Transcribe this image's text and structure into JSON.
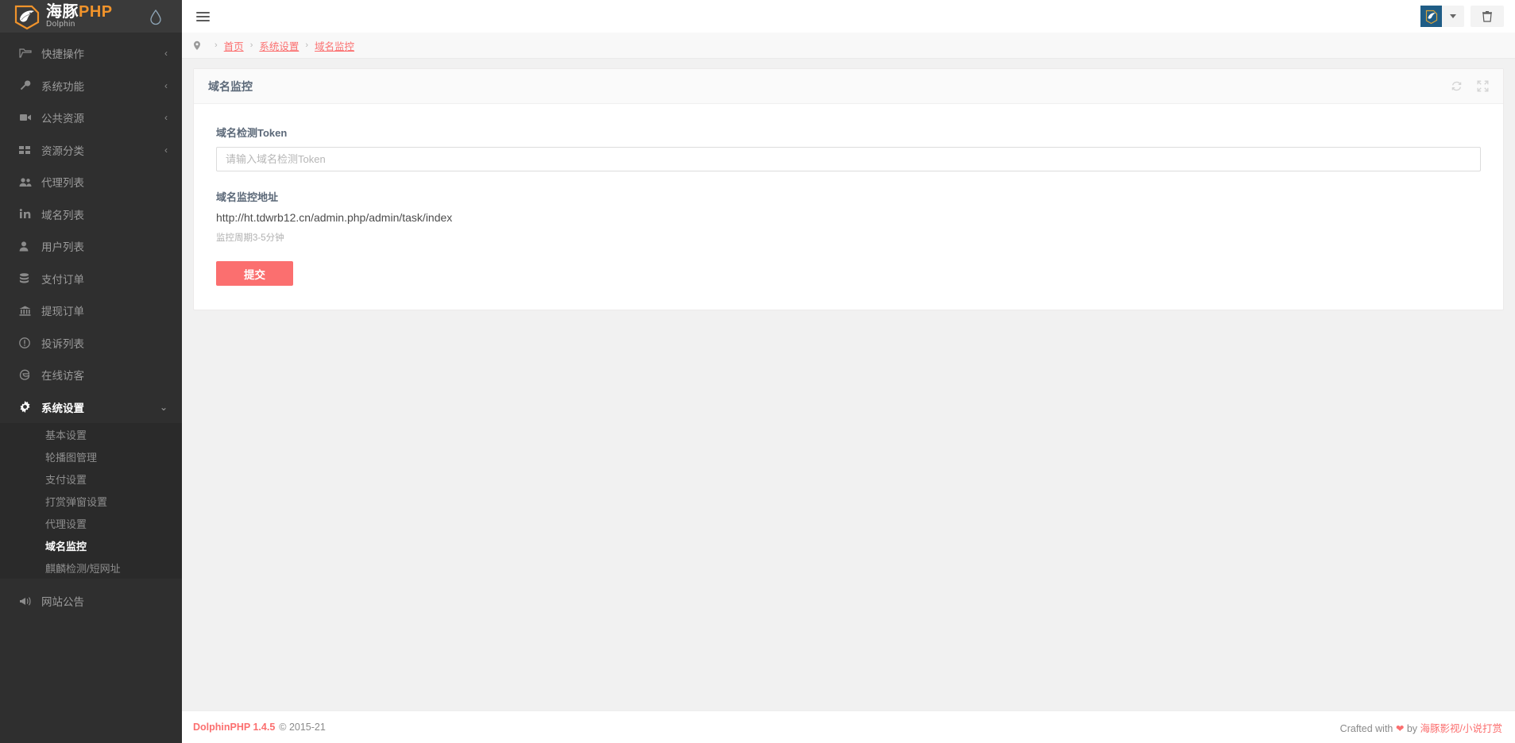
{
  "colors": {
    "sidebar_bg": "#2f2f2f",
    "submenu_bg": "#2a2a2a",
    "accent_red": "#fb6f6f",
    "logo_orange": "#f0932b",
    "avatar_blue": "#1f5d86"
  },
  "logo": {
    "cn": "海豚",
    "php": "PHP",
    "sub": "Dolphin",
    "mark_icon": "dolphin-logo-icon",
    "theme_icon": "water-drop-icon"
  },
  "sidebar": {
    "items": [
      {
        "label": "快捷操作",
        "icon": "folder-open-icon",
        "arrow": "‹",
        "expandable": true,
        "active": false
      },
      {
        "label": "系统功能",
        "icon": "wrench-icon",
        "arrow": "‹",
        "expandable": true,
        "active": false
      },
      {
        "label": "公共资源",
        "icon": "video-camera-icon",
        "arrow": "‹",
        "expandable": true,
        "active": false
      },
      {
        "label": "资源分类",
        "icon": "grid-icon",
        "arrow": "‹",
        "expandable": true,
        "active": false
      },
      {
        "label": "代理列表",
        "icon": "users-icon",
        "arrow": "",
        "expandable": false,
        "active": false
      },
      {
        "label": "域名列表",
        "icon": "linkedin-in-icon",
        "arrow": "",
        "expandable": false,
        "active": false
      },
      {
        "label": "用户列表",
        "icon": "user-icon",
        "arrow": "",
        "expandable": false,
        "active": false
      },
      {
        "label": "支付订单",
        "icon": "database-icon",
        "arrow": "",
        "expandable": false,
        "active": false
      },
      {
        "label": "提现订单",
        "icon": "bank-icon",
        "arrow": "",
        "expandable": false,
        "active": false
      },
      {
        "label": "投诉列表",
        "icon": "exclamation-circle-icon",
        "arrow": "",
        "expandable": false,
        "active": false
      },
      {
        "label": "在线访客",
        "icon": "edge-browser-icon",
        "arrow": "",
        "expandable": false,
        "active": false
      },
      {
        "label": "系统设置",
        "icon": "gear-icon",
        "arrow": "⌄",
        "expandable": true,
        "active": true
      }
    ],
    "submenu": [
      {
        "label": "基本设置",
        "active": false
      },
      {
        "label": "轮播图管理",
        "active": false
      },
      {
        "label": "支付设置",
        "active": false
      },
      {
        "label": "打赏弹窗设置",
        "active": false
      },
      {
        "label": "代理设置",
        "active": false
      },
      {
        "label": "域名监控",
        "active": true
      },
      {
        "label": "麒麟检测/短网址",
        "active": false
      }
    ],
    "bottom_item": {
      "label": "网站公告",
      "icon": "megaphone-icon"
    }
  },
  "topbar": {
    "menu_toggle_icon": "hamburger-icon",
    "user_avatar_icon": "dolphin-avatar-icon",
    "dropdown_icon": "caret-down-icon",
    "trash_icon": "trash-icon"
  },
  "breadcrumb": {
    "pin_icon": "location-pin-icon",
    "separator": "›",
    "items": [
      "首页",
      "系统设置",
      "域名监控"
    ]
  },
  "card": {
    "title": "域名监控",
    "refresh_icon": "refresh-icon",
    "fullscreen_icon": "expand-icon"
  },
  "form": {
    "token_label": "域名检测Token",
    "token_value": "",
    "token_placeholder": "请输入域名检测Token",
    "url_label": "域名监控地址",
    "url_value": "http://ht.tdwrb12.cn/admin.php/admin/task/index",
    "help_text": "监控周期3-5分钟",
    "submit_label": "提交"
  },
  "footer": {
    "brand": "DolphinPHP 1.4.5",
    "copyright": "© 2015-21",
    "crafted_prefix": "Crafted with",
    "heart": "❤",
    "crafted_by": "by",
    "author": "海豚影视/小说打赏"
  }
}
